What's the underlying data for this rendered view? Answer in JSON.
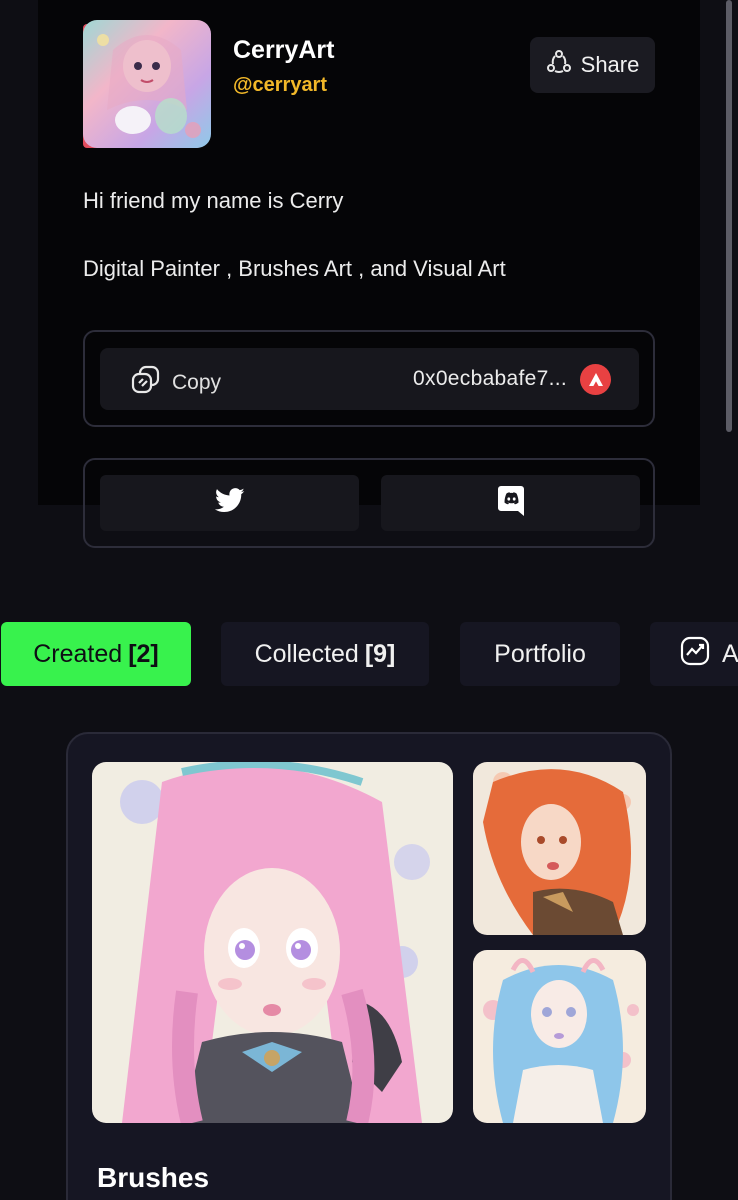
{
  "profile": {
    "display_name": "CerryArt",
    "handle": "@cerryart",
    "share_label": "Share",
    "bio_line_1": "Hi friend my name is Cerry",
    "bio_line_2": "Digital Painter , Brushes Art , and Visual Art"
  },
  "wallet": {
    "copy_label": "Copy",
    "address": "0x0ecbabafe7...",
    "chain_icon": "avalanche-icon"
  },
  "socials": [
    {
      "icon": "twitter-icon"
    },
    {
      "icon": "discord-icon"
    }
  ],
  "tabs": [
    {
      "label": "Created",
      "count": "[2]",
      "active": true
    },
    {
      "label": "Collected",
      "count": "[9]",
      "active": false
    },
    {
      "label": "Portfolio",
      "count": "",
      "active": false
    },
    {
      "label": "A",
      "icon": "activity-chart-icon",
      "active": false
    }
  ],
  "collection": {
    "title": "Brushes"
  },
  "colors": {
    "accent_green": "#38f24d",
    "handle_yellow": "#f2b829",
    "avax_red": "#e84142",
    "background": "#0e0e14"
  }
}
